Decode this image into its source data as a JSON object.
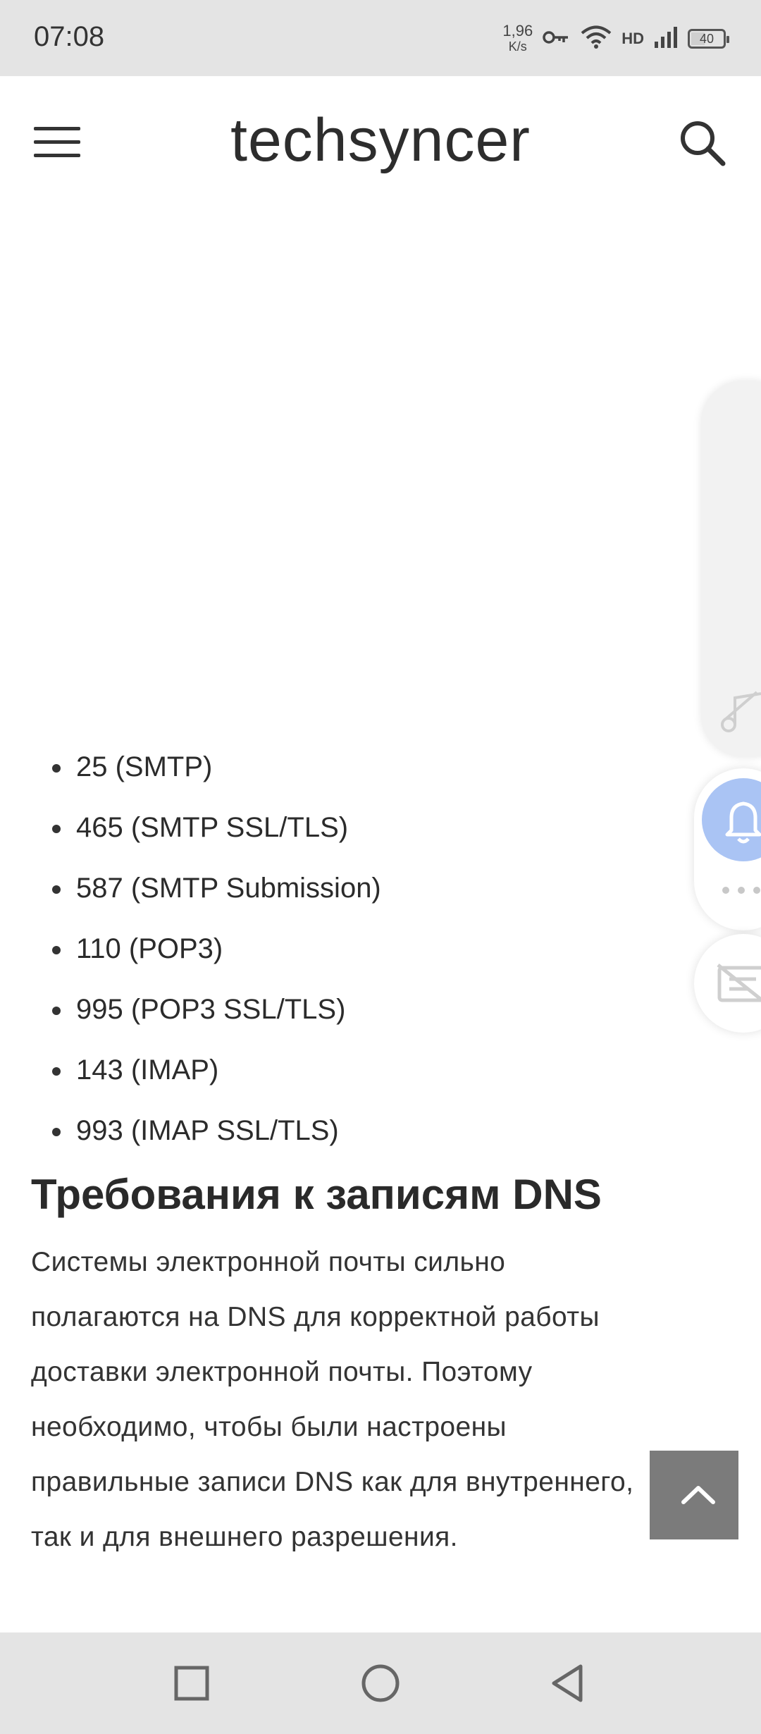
{
  "status_bar": {
    "time": "07:08",
    "net_speed": "1,96",
    "net_unit": "K/s",
    "network_type": "HD",
    "battery": "40"
  },
  "header": {
    "site_title": "techsyncer",
    "menu_icon": "hamburger-menu-icon",
    "search_icon": "search-icon"
  },
  "article": {
    "ports": [
      "25 (SMTP)",
      "465 (SMTP SSL/TLS)",
      "587 (SMTP Submission)",
      "110 (POP3)",
      "995 (POP3 SSL/TLS)",
      "143 (IMAP)",
      "993 (IMAP SSL/TLS)"
    ],
    "section_title": "Требования к записям DNS",
    "paragraph_lines": [
      "Системы электронной почты сильно",
      "полагаются на DNS для корректной работы",
      "доставки электронной почты. Поэтому",
      "необходимо, чтобы были настроены",
      "правильные записи DNS как для внутреннего,",
      "так и для внешнего разрешения."
    ]
  },
  "floating": {
    "music_icon": "music-note-icon",
    "bell_icon": "bell-icon",
    "more_icon": "more-dots-icon",
    "card_icon": "subtitles-off-icon",
    "accent": "#aac4f4"
  },
  "scroll_top": {
    "icon": "chevron-up-icon",
    "color": "#7b7b7b"
  },
  "nav_bar": {
    "recents": "square-icon",
    "home": "circle-icon",
    "back": "triangle-back-icon"
  }
}
